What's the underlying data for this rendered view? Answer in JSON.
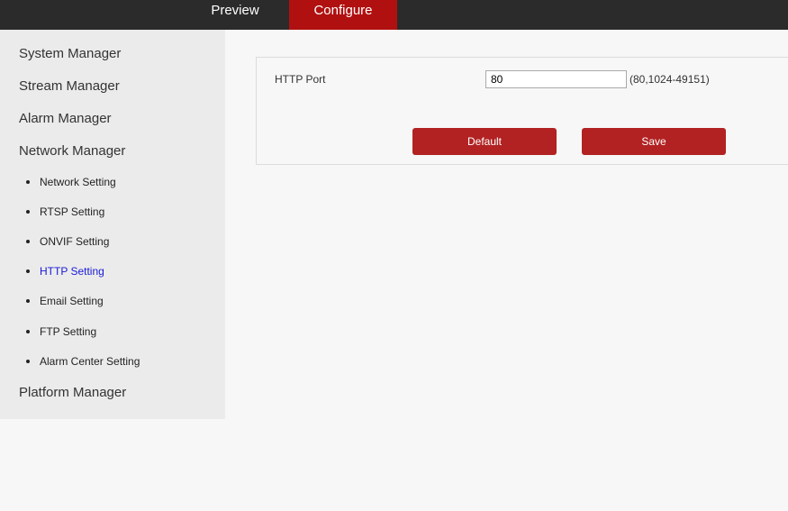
{
  "nav": {
    "tabs": [
      {
        "label": "Preview"
      },
      {
        "label": "Configure"
      }
    ],
    "active_tab": "Configure",
    "active_color": "#b01010"
  },
  "sidebar": {
    "menus": [
      {
        "label": "System Manager"
      },
      {
        "label": "Stream Manager"
      },
      {
        "label": "Alarm Manager"
      },
      {
        "label": "Network Manager"
      },
      {
        "label": "Platform Manager"
      }
    ],
    "network_items": [
      {
        "label": "Network Setting"
      },
      {
        "label": "RTSP Setting"
      },
      {
        "label": "ONVIF Setting"
      },
      {
        "label": "HTTP Setting"
      },
      {
        "label": "Email Setting"
      },
      {
        "label": "FTP Setting"
      },
      {
        "label": "Alarm Center Setting"
      }
    ],
    "active_item": "HTTP Setting",
    "active_color": "#1a1ad6"
  },
  "http": {
    "port_label": "HTTP Port",
    "port_value": "80",
    "port_hint": "(80,1024-49151)"
  },
  "buttons": {
    "default_label": "Default",
    "save_label": "Save",
    "color": "#b22222"
  }
}
